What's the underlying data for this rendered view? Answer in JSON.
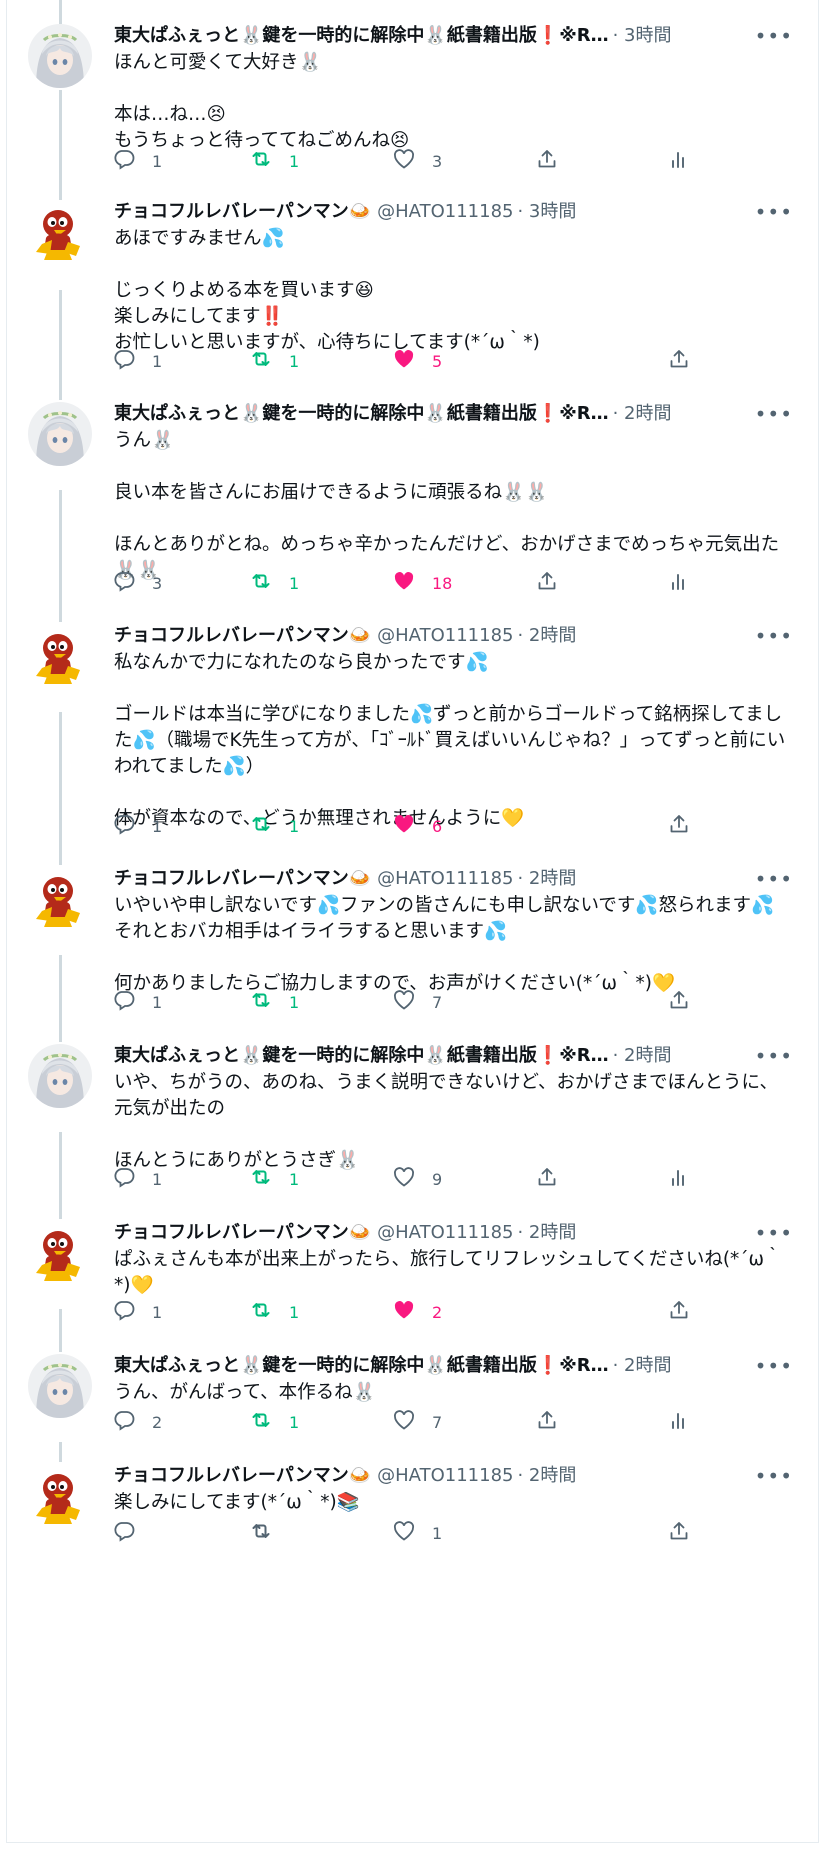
{
  "tweets": [
    {
      "author": "A",
      "name": "東大ぱふぇっと🐰鍵を一時的に解除中🐰紙書籍出版❗※R…",
      "handle": "",
      "time": "· 3時間",
      "paragraphs": [
        "ほんと可愛くて大好き🐰",
        "本は…ね…😣\nもうちょっと待っててねごめんね😣"
      ],
      "reply_count": "1",
      "retweet_count": "1",
      "like_count": "3",
      "liked": false,
      "last_action": "analytics"
    },
    {
      "author": "B",
      "name": "チョコフルレバレーパンマン🍛",
      "handle": "@HATO111185",
      "time": "· 3時間",
      "paragraphs": [
        "あほですみません💦",
        "じっくりよめる本を買います😆\n楽しみにしてます‼️\nお忙しいと思いますが、心待ちにしてます(*´ω｀*)"
      ],
      "reply_count": "1",
      "retweet_count": "1",
      "like_count": "5",
      "liked": true,
      "last_action": "share"
    },
    {
      "author": "A",
      "name": "東大ぱふぇっと🐰鍵を一時的に解除中🐰紙書籍出版❗※R…",
      "handle": "",
      "time": "· 2時間",
      "paragraphs": [
        "うん🐰",
        "良い本を皆さんにお届けできるように頑張るね🐰🐰",
        "ほんとありがとね。めっちゃ辛かったんだけど、おかげさまでめっちゃ元気出た🐰🐰"
      ],
      "reply_count": "3",
      "retweet_count": "1",
      "like_count": "18",
      "liked": true,
      "last_action": "analytics"
    },
    {
      "author": "B",
      "name": "チョコフルレバレーパンマン🍛",
      "handle": "@HATO111185",
      "time": "· 2時間",
      "paragraphs": [
        "私なんかで力になれたのなら良かったです💦",
        "ゴールドは本当に学びになりました💦ずっと前からゴールドって銘柄探してました💦（職場でK先生って方が、「ｺﾞｰﾙﾄﾞ買えばいいんじゃね？」ってずっと前にいわれてました💦）",
        "体が資本なので、どうか無理されませんように💛"
      ],
      "reply_count": "1",
      "retweet_count": "1",
      "like_count": "6",
      "liked": true,
      "last_action": "share"
    },
    {
      "author": "B",
      "name": "チョコフルレバレーパンマン🍛",
      "handle": "@HATO111185",
      "time": "· 2時間",
      "paragraphs": [
        "いやいや申し訳ないです💦ファンの皆さんにも申し訳ないです💦怒られます💦それとおバカ相手はイライラすると思います💦",
        "何かありましたらご協力しますので、お声がけください(*´ω｀*)💛"
      ],
      "reply_count": "1",
      "retweet_count": "1",
      "like_count": "7",
      "liked": false,
      "last_action": "share"
    },
    {
      "author": "A",
      "name": "東大ぱふぇっと🐰鍵を一時的に解除中🐰紙書籍出版❗※R…",
      "handle": "",
      "time": "· 2時間",
      "paragraphs": [
        "いや、ちがうの、あのね、うまく説明できないけど、おかげさまでほんとうに、元気が出たの",
        "ほんとうにありがとうさぎ🐰"
      ],
      "reply_count": "1",
      "retweet_count": "1",
      "like_count": "9",
      "liked": false,
      "last_action": "analytics"
    },
    {
      "author": "B",
      "name": "チョコフルレバレーパンマン🍛",
      "handle": "@HATO111185",
      "time": "· 2時間",
      "paragraphs": [
        "ぱふぇさんも本が出来上がったら、旅行してリフレッシュしてくださいね(*´ω｀*)💛"
      ],
      "reply_count": "1",
      "retweet_count": "1",
      "like_count": "2",
      "liked": true,
      "last_action": "share"
    },
    {
      "author": "A",
      "name": "東大ぱふぇっと🐰鍵を一時的に解除中🐰紙書籍出版❗※R…",
      "handle": "",
      "time": "· 2時間",
      "paragraphs": [
        "うん、がんばって、本作るね🐰"
      ],
      "reply_count": "2",
      "retweet_count": "1",
      "like_count": "7",
      "liked": false,
      "last_action": "analytics"
    },
    {
      "author": "B",
      "name": "チョコフルレバレーパンマン🍛",
      "handle": "@HATO111185",
      "time": "· 2時間",
      "paragraphs": [
        "楽しみにしてます(*´ω｀*)📚"
      ],
      "reply_count": "",
      "retweet_count": "",
      "like_count": "1",
      "liked": false,
      "last_action": "share"
    }
  ],
  "icons": {
    "reply": "reply-icon",
    "retweet": "retweet-icon",
    "like": "heart-icon",
    "share": "share-icon",
    "analytics": "analytics-icon",
    "more": "more-icon"
  },
  "colors": {
    "like_active": "#f91880",
    "retweet": "#00ba7c",
    "muted": "#536471",
    "thread_line": "#cfd9de"
  }
}
